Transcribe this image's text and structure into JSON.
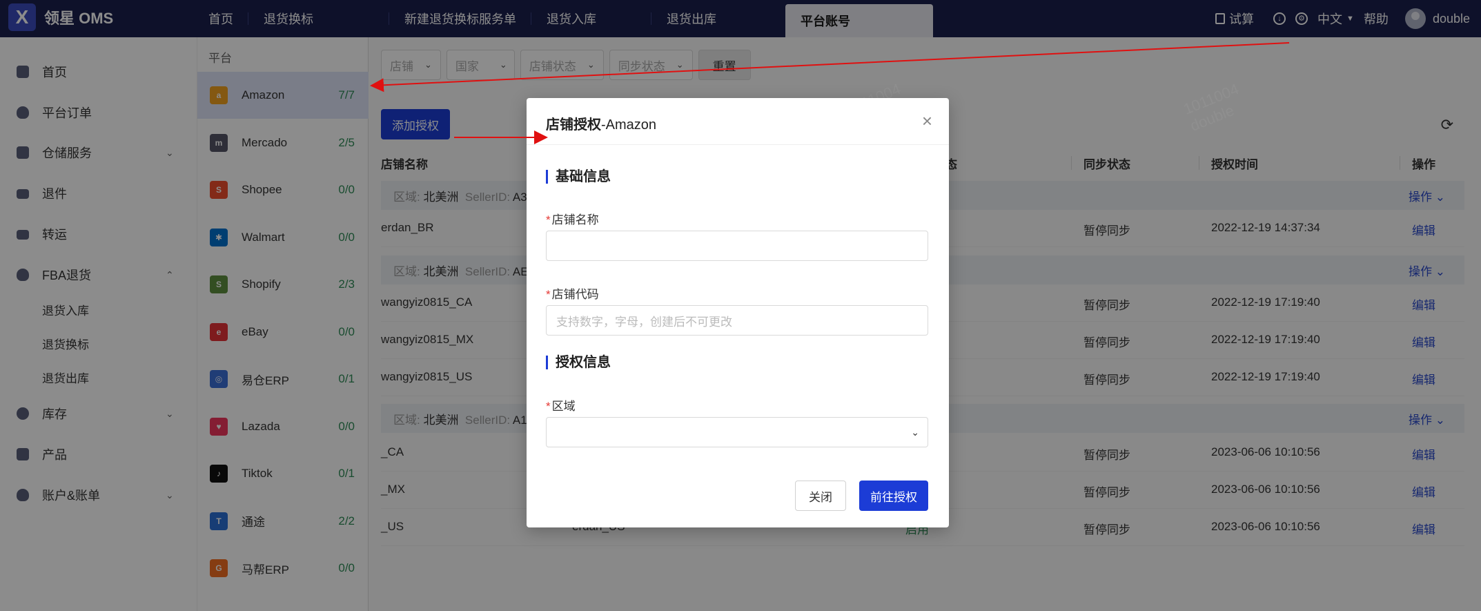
{
  "app": {
    "logo_text": "领星 OMS",
    "logo_mark": "X"
  },
  "header": {
    "tabs": [
      {
        "label": "首页"
      },
      {
        "label": "退货换标"
      },
      {
        "label": "新建退货换标服务单"
      },
      {
        "label": "退货入库"
      },
      {
        "label": "退货出库"
      },
      {
        "label": "平台账号",
        "active": true
      }
    ],
    "trial_label": "试算",
    "lang_label": "中文",
    "help_label": "帮助",
    "user_name": "double"
  },
  "sidebar": {
    "items": [
      {
        "label": "首页",
        "icon": "home-icon"
      },
      {
        "label": "平台订单",
        "icon": "shield-icon"
      },
      {
        "label": "仓储服务",
        "icon": "warehouse-icon",
        "chevron": "down"
      },
      {
        "label": "退件",
        "icon": "truck-icon"
      },
      {
        "label": "转运",
        "icon": "truck-icon"
      },
      {
        "label": "FBA退货",
        "icon": "shield-icon",
        "chevron": "up"
      },
      {
        "label": "库存",
        "icon": "pie-chart-icon",
        "chevron": "down"
      },
      {
        "label": "产品",
        "icon": "box-icon"
      },
      {
        "label": "账户&账单",
        "icon": "shield-icon",
        "chevron": "down"
      }
    ],
    "fba_sub": [
      "退货入库",
      "退货换标",
      "退货出库"
    ]
  },
  "platforms": {
    "title": "平台",
    "items": [
      {
        "name": "Amazon",
        "count": "7/7",
        "color": "#f0a020",
        "active": true
      },
      {
        "name": "Mercado",
        "count": "2/5",
        "color": "#556"
      },
      {
        "name": "Shopee",
        "count": "0/0",
        "color": "#ee4d2d"
      },
      {
        "name": "Walmart",
        "count": "0/0",
        "color": "#0071ce"
      },
      {
        "name": "Shopify",
        "count": "2/3",
        "color": "#5e8e3e"
      },
      {
        "name": "eBay",
        "count": "0/0",
        "color": "#e53238"
      },
      {
        "name": "易仓ERP",
        "count": "0/1",
        "color": "#3b6fd8"
      },
      {
        "name": "Lazada",
        "count": "0/0",
        "color": "#f0365e"
      },
      {
        "name": "Tiktok",
        "count": "0/1",
        "color": "#111"
      },
      {
        "name": "通途",
        "count": "2/2",
        "color": "#2a6fd6"
      },
      {
        "name": "马帮ERP",
        "count": "0/0",
        "color": "#f26d21"
      }
    ]
  },
  "filters": {
    "shop": "店铺",
    "country": "国家",
    "shop_status": "店铺状态",
    "sync_status": "同步状态",
    "reset_label": "重置"
  },
  "toolbar": {
    "add_label": "添加授权"
  },
  "table": {
    "headers": [
      "店铺名称",
      "状态",
      "同步状态",
      "授权时间",
      "操作"
    ],
    "status_header_tail": "态",
    "groups": [
      {
        "region_label": "区域:",
        "region": "北美洲",
        "seller_label": "SellerID:",
        "seller_value": "A3",
        "op_label": "操作",
        "rows": [
          {
            "name": "erdan_BR",
            "sync": "暂停同步",
            "time": "2022-12-19 14:37:34",
            "action": "编辑"
          }
        ]
      },
      {
        "region_label": "区域:",
        "region": "北美洲",
        "seller_label": "SellerID:",
        "seller_value": "AE",
        "op_label": "操作",
        "rows": [
          {
            "name": "wangyiz0815_CA",
            "sync": "暂停同步",
            "time": "2022-12-19 17:19:40",
            "action": "编辑"
          },
          {
            "name": "wangyiz0815_MX",
            "sync": "暂停同步",
            "time": "2022-12-19 17:19:40",
            "action": "编辑"
          },
          {
            "name": "wangyiz0815_US",
            "sync": "暂停同步",
            "time": "2022-12-19 17:19:40",
            "action": "编辑"
          }
        ]
      },
      {
        "region_label": "区域:",
        "region": "北美洲",
        "seller_label": "SellerID:",
        "seller_value": "A1",
        "op_label": "操作",
        "rows": [
          {
            "name": "_CA",
            "sync": "暂停同步",
            "time": "2023-06-06 10:10:56",
            "action": "编辑"
          },
          {
            "name": "_MX",
            "sync": "暂停同步",
            "time": "2023-06-06 10:10:56",
            "action": "编辑"
          },
          {
            "name": "_US",
            "code": "erdan_US",
            "dash": "-",
            "status": "启用",
            "sync": "暂停同步",
            "time": "2023-06-06 10:10:56",
            "action": "编辑"
          }
        ]
      }
    ]
  },
  "watermark": {
    "line1": "1011004",
    "line2": "double"
  },
  "modal": {
    "title_prefix": "店铺授权",
    "title_suffix": "-Amazon",
    "section_basic": "基础信息",
    "shop_name_label": "店铺名称",
    "shop_name_value": "",
    "shop_code_label": "店铺代码",
    "shop_code_placeholder": "支持数字，字母，创建后不可更改",
    "section_auth": "授权信息",
    "region_label": "区域",
    "region_value": "",
    "close_label": "关闭",
    "go_label": "前往授权",
    "required_mark": "*"
  }
}
